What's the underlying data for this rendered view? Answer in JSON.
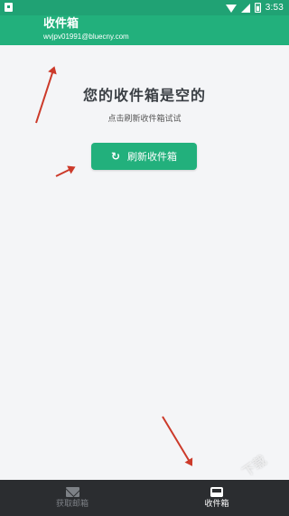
{
  "status_bar": {
    "time": "3:53",
    "icons": [
      "notification-icon",
      "wifi-icon",
      "cell-signal-icon",
      "battery-icon"
    ]
  },
  "app_bar": {
    "title": "收件箱",
    "email": "wvjpv01991@bluecny.com"
  },
  "empty_state": {
    "title": "您的收件箱是空的",
    "hint": "点击刷新收件箱试试",
    "refresh_button_label": "刷新收件箱",
    "refresh_icon": "refresh-icon"
  },
  "bottom_nav": {
    "items": [
      {
        "label": "获取邮箱",
        "icon": "mail-icon",
        "active": false
      },
      {
        "label": "收件箱",
        "icon": "inbox-icon",
        "active": true
      }
    ]
  },
  "colors": {
    "accent": "#22b07c",
    "status_bar": "#20a274",
    "nav_background": "#2b2d30",
    "annotation_arrow": "#cc3a2a"
  },
  "watermark": "下载"
}
